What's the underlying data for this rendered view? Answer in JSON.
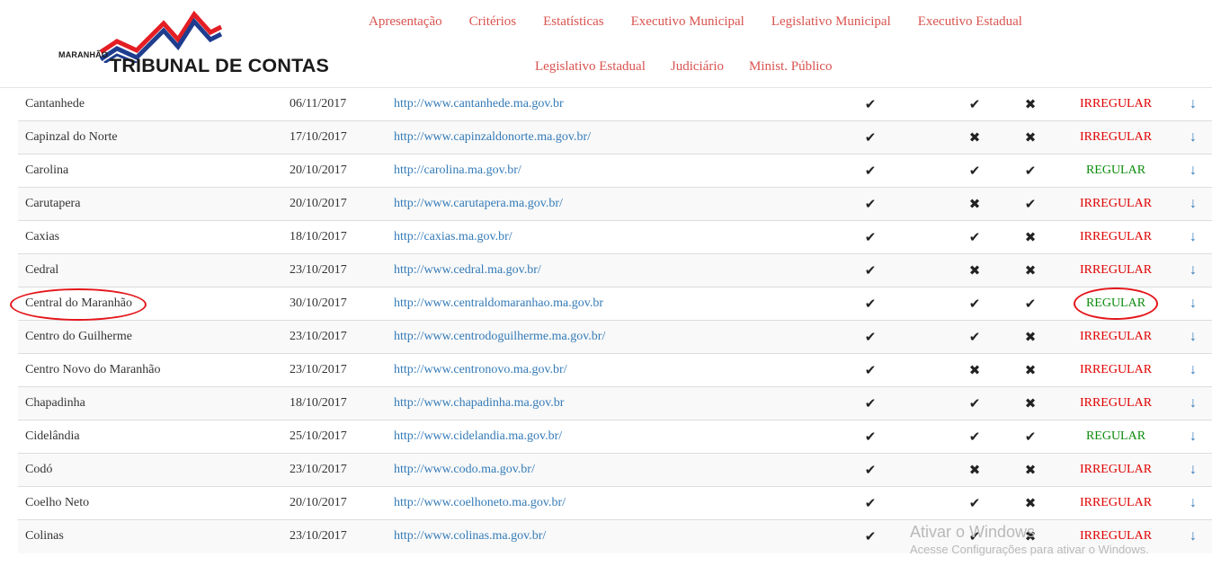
{
  "logo": {
    "small_text": "MARANHÃO",
    "main_text": "TRIBUNAL DE CONTAS",
    "colors": {
      "red": "#e31e24",
      "blue": "#1f3d8f"
    }
  },
  "nav": {
    "row1": [
      "Apresentação",
      "Critérios",
      "Estatísticas",
      "Executivo Municipal",
      "Legislativo Municipal",
      "Executivo Estadual"
    ],
    "row2": [
      "Legislativo Estadual",
      "Judiciário",
      "Minist. Público"
    ]
  },
  "icons": {
    "check": "check-icon",
    "cross": "cross-icon",
    "download": "download-arrow-icon"
  },
  "colors": {
    "irregular": "#e00000",
    "regular": "#0b8b0b",
    "link": "#337ab7",
    "nav": "#d9534f",
    "annotation": "#e4161b"
  },
  "rows": [
    {
      "name": "Cantanhede",
      "date": "06/11/2017",
      "url": "http://www.cantanhede.ma.gov.br",
      "c1": "check",
      "c2": "check",
      "c3": "cross",
      "status": "IRREGULAR"
    },
    {
      "name": "Capinzal do Norte",
      "date": "17/10/2017",
      "url": "http://www.capinzaldonorte.ma.gov.br/",
      "c1": "check",
      "c2": "cross",
      "c3": "cross",
      "status": "IRREGULAR"
    },
    {
      "name": "Carolina",
      "date": "20/10/2017",
      "url": "http://carolina.ma.gov.br/",
      "c1": "check",
      "c2": "check",
      "c3": "check",
      "status": "REGULAR"
    },
    {
      "name": "Carutapera",
      "date": "20/10/2017",
      "url": "http://www.carutapera.ma.gov.br/",
      "c1": "check",
      "c2": "cross",
      "c3": "check",
      "status": "IRREGULAR"
    },
    {
      "name": "Caxias",
      "date": "18/10/2017",
      "url": "http://caxias.ma.gov.br/",
      "c1": "check",
      "c2": "check",
      "c3": "cross",
      "status": "IRREGULAR"
    },
    {
      "name": "Cedral",
      "date": "23/10/2017",
      "url": "http://www.cedral.ma.gov.br/",
      "c1": "check",
      "c2": "cross",
      "c3": "cross",
      "status": "IRREGULAR"
    },
    {
      "name": "Central do Maranhão",
      "date": "30/10/2017",
      "url": "http://www.centraldomaranhao.ma.gov.br",
      "c1": "check",
      "c2": "check",
      "c3": "check",
      "status": "REGULAR",
      "highlighted": true
    },
    {
      "name": "Centro do Guilherme",
      "date": "23/10/2017",
      "url": "http://www.centrodoguilherme.ma.gov.br/",
      "c1": "check",
      "c2": "check",
      "c3": "cross",
      "status": "IRREGULAR"
    },
    {
      "name": "Centro Novo do Maranhão",
      "date": "23/10/2017",
      "url": "http://www.centronovo.ma.gov.br/",
      "c1": "check",
      "c2": "cross",
      "c3": "cross",
      "status": "IRREGULAR"
    },
    {
      "name": "Chapadinha",
      "date": "18/10/2017",
      "url": "http://www.chapadinha.ma.gov.br",
      "c1": "check",
      "c2": "check",
      "c3": "cross",
      "status": "IRREGULAR"
    },
    {
      "name": "Cidelândia",
      "date": "25/10/2017",
      "url": "http://www.cidelandia.ma.gov.br/",
      "c1": "check",
      "c2": "check",
      "c3": "check",
      "status": "REGULAR"
    },
    {
      "name": "Codó",
      "date": "23/10/2017",
      "url": "http://www.codo.ma.gov.br/",
      "c1": "check",
      "c2": "cross",
      "c3": "cross",
      "status": "IRREGULAR"
    },
    {
      "name": "Coelho Neto",
      "date": "20/10/2017",
      "url": "http://www.coelhoneto.ma.gov.br/",
      "c1": "check",
      "c2": "check",
      "c3": "cross",
      "status": "IRREGULAR"
    },
    {
      "name": "Colinas",
      "date": "23/10/2017",
      "url": "http://www.colinas.ma.gov.br/",
      "c1": "check",
      "c2": "check",
      "c3": "cross",
      "status": "IRREGULAR"
    }
  ],
  "watermark": {
    "title": "Ativar o Windows",
    "subtitle": "Acesse Configurações para ativar o Windows."
  }
}
